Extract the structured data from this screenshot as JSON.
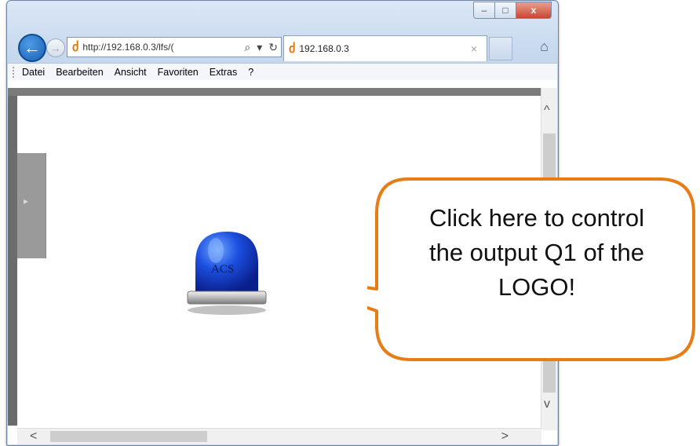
{
  "window": {
    "controls": {
      "minimize": "–",
      "maximize": "□",
      "close": "x"
    }
  },
  "navigation": {
    "back_icon": "←",
    "forward_icon": "→",
    "address_text": "http://192.168.0.3/lfs/(",
    "search_icon": "⌕",
    "dropdown_icon": "▾",
    "refresh_icon": "↻",
    "home_icon": "⌂"
  },
  "tab": {
    "title": "192.168.0.3",
    "close_icon": "×"
  },
  "menu": {
    "items": [
      "Datei",
      "Bearbeiten",
      "Ansicht",
      "Favoriten",
      "Extras",
      "?"
    ]
  },
  "page": {
    "side_panel_arrow": "▸",
    "lamp_label": "ACS"
  },
  "scrollbars": {
    "up": "^",
    "down": "v",
    "left": "<",
    "right": ">"
  },
  "callout": {
    "lines": [
      "Click here to control",
      "the output Q1 of the",
      "LOGO!"
    ],
    "border_color": "#e87c16"
  }
}
